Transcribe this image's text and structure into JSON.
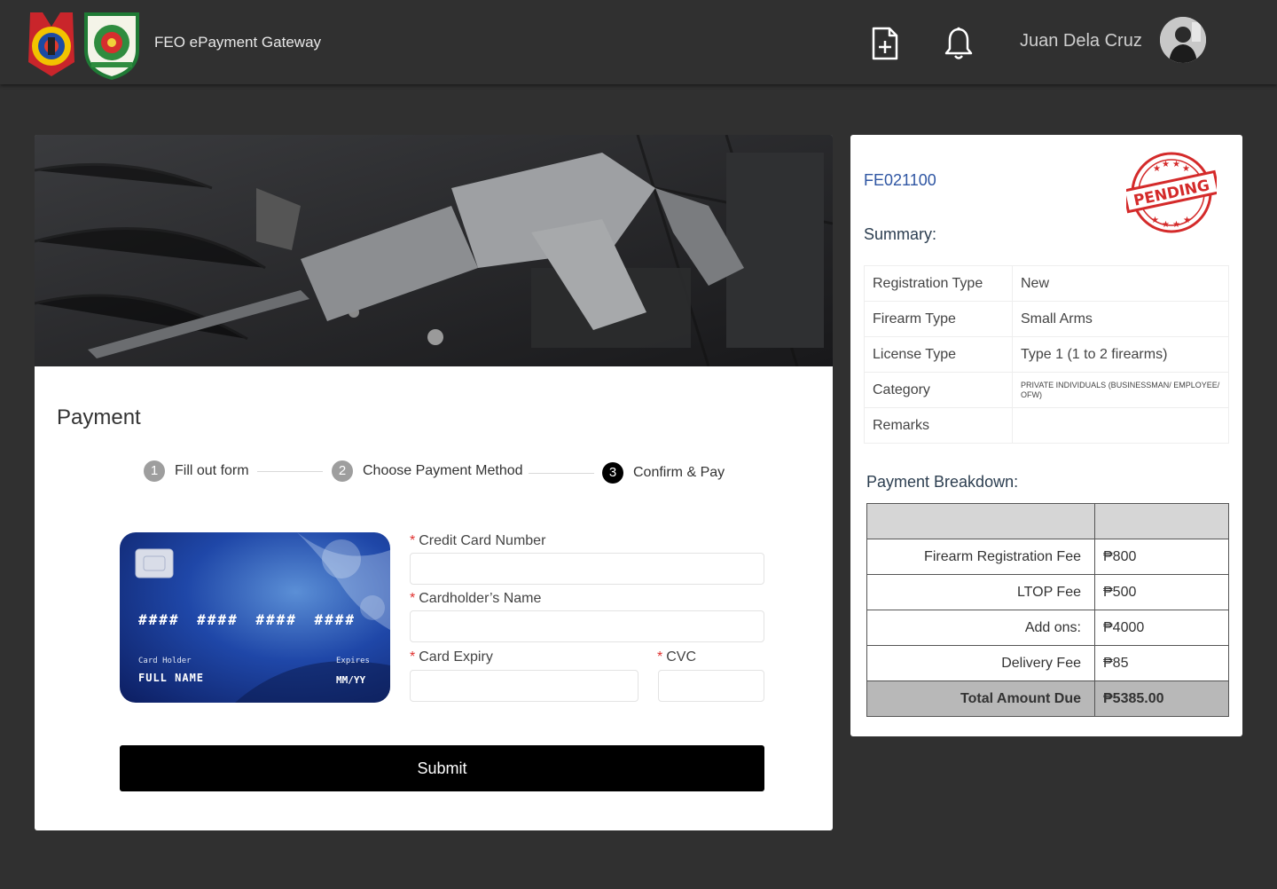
{
  "header": {
    "app_title": "FEO ePayment Gateway",
    "user_name": "Juan Dela Cruz",
    "icons": [
      "pnp-logo",
      "feo-logo",
      "new-document-icon",
      "bell-icon",
      "avatar"
    ]
  },
  "main": {
    "page_title": "Payment",
    "steps": [
      {
        "number": "1",
        "label": "Fill out form",
        "state": "done"
      },
      {
        "number": "2",
        "label": "Choose Payment Method",
        "state": "done"
      },
      {
        "number": "3",
        "label": "Confirm & Pay",
        "state": "active"
      }
    ],
    "card_preview": {
      "number": "#### #### #### ####",
      "holder_label": "Card Holder",
      "holder": "FULL NAME",
      "expiry_label": "Expires",
      "expiry": "MM/YY"
    },
    "form": {
      "required_mark": "*",
      "card_number_label": "Credit Card Number",
      "card_number_value": "",
      "cardholder_label": "Cardholder’s Name",
      "cardholder_value": "",
      "expiry_label": "Card Expiry",
      "expiry_value": "",
      "cvc_label": "CVC",
      "cvc_value": ""
    },
    "submit_label": "Submit"
  },
  "side": {
    "reference": "FE021100",
    "stamp_text": "PENDING",
    "summary_title": "Summary:",
    "summary": [
      {
        "key": "Registration Type",
        "value": "New"
      },
      {
        "key": "Firearm Type",
        "value": "Small Arms"
      },
      {
        "key": "License Type",
        "value": "Type 1 (1 to 2 firearms)"
      },
      {
        "key": "Category",
        "value": "PRIVATE INDIVIDUALS (BUSINESSMAN/ EMPLOYEE/ OFW)"
      },
      {
        "key": "Remarks",
        "value": ""
      }
    ],
    "breakdown_title": "Payment Breakdown:",
    "breakdown": [
      {
        "key": "Firearm Registration Fee",
        "value": "₱800"
      },
      {
        "key": "LTOP Fee",
        "value": "₱500"
      },
      {
        "key": "Add ons:",
        "value": "₱4000"
      },
      {
        "key": "Delivery Fee",
        "value": "₱85"
      }
    ],
    "total_label": "Total Amount Due",
    "total_value": "₱5385.00"
  },
  "colors": {
    "background": "#303030",
    "accent_link": "#2f56a3",
    "step_done": "#9e9e9e",
    "step_active": "#000000",
    "required": "#e0312f",
    "stamp": "#d42a2a"
  }
}
